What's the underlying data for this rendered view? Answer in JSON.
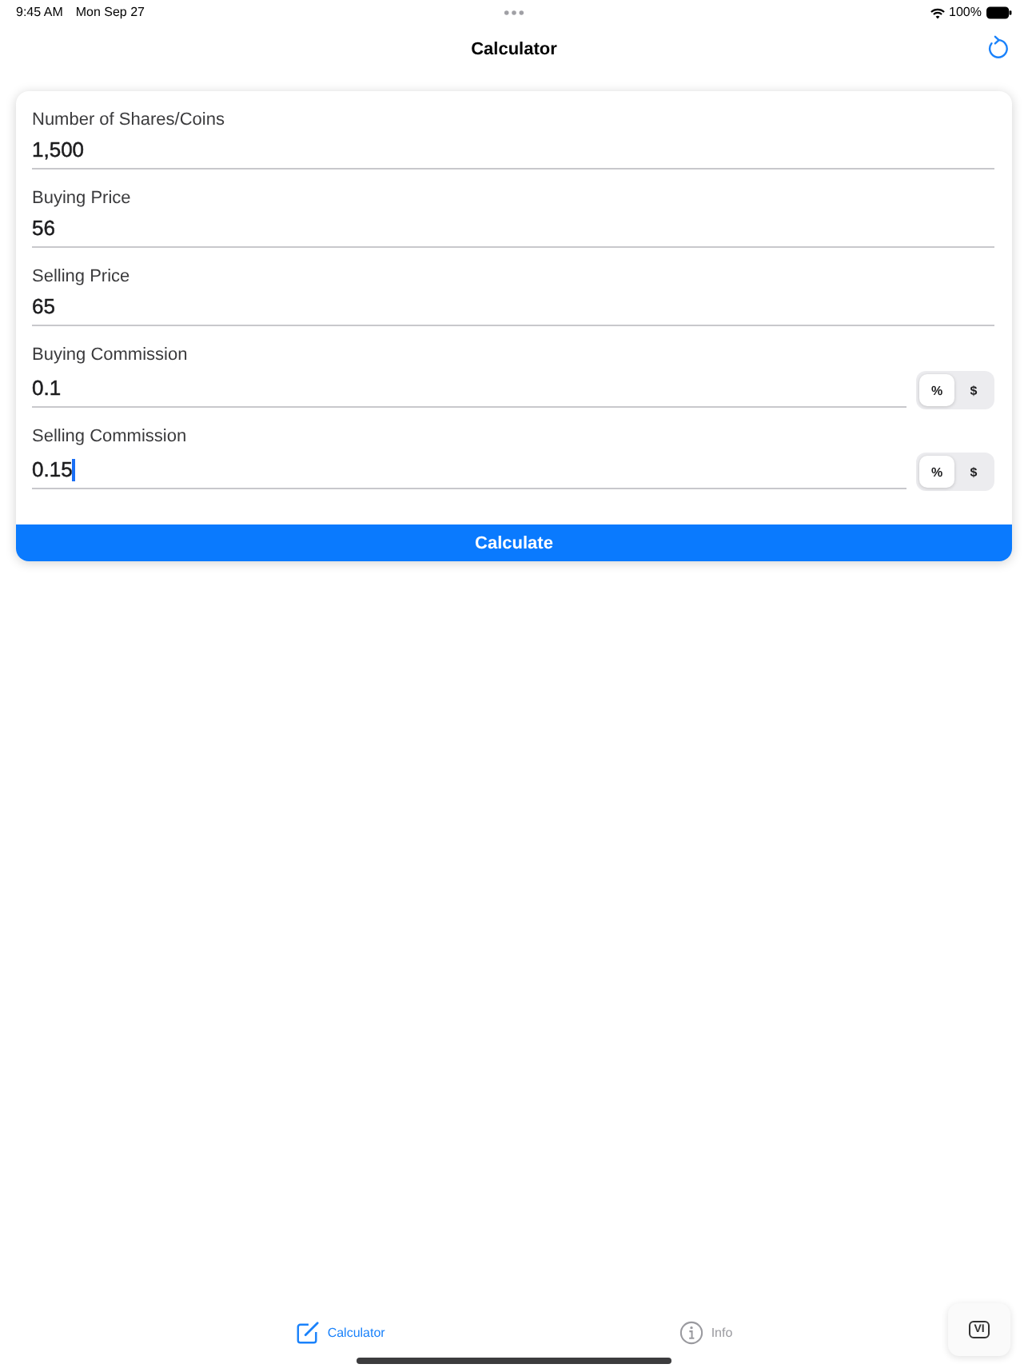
{
  "status_bar": {
    "time": "9:45 AM",
    "date": "Mon Sep 27",
    "battery_text": "100%"
  },
  "nav": {
    "title": "Calculator"
  },
  "form": {
    "fields": [
      {
        "kind": "plain",
        "label": "Number of Shares/Coins",
        "value": "1,500",
        "focused": false
      },
      {
        "kind": "plain",
        "label": "Buying Price",
        "value": "56",
        "focused": false
      },
      {
        "kind": "plain",
        "label": "Selling Price",
        "value": "65",
        "focused": false
      },
      {
        "kind": "commission",
        "label": "Buying Commission",
        "value": "0.1",
        "focused": false,
        "units": [
          {
            "label": "%",
            "selected": true
          },
          {
            "label": "$",
            "selected": false
          }
        ]
      },
      {
        "kind": "commission",
        "label": "Selling Commission",
        "value": "0.15",
        "focused": true,
        "units": [
          {
            "label": "%",
            "selected": true
          },
          {
            "label": "$",
            "selected": false
          }
        ]
      }
    ],
    "submit": {
      "label": "Calculate"
    }
  },
  "tabs": [
    {
      "kind": "calculator",
      "label": "Calculator",
      "selected": true
    },
    {
      "kind": "info",
      "label": "Info",
      "selected": false
    }
  ],
  "floating_button": {
    "label": "VI"
  }
}
